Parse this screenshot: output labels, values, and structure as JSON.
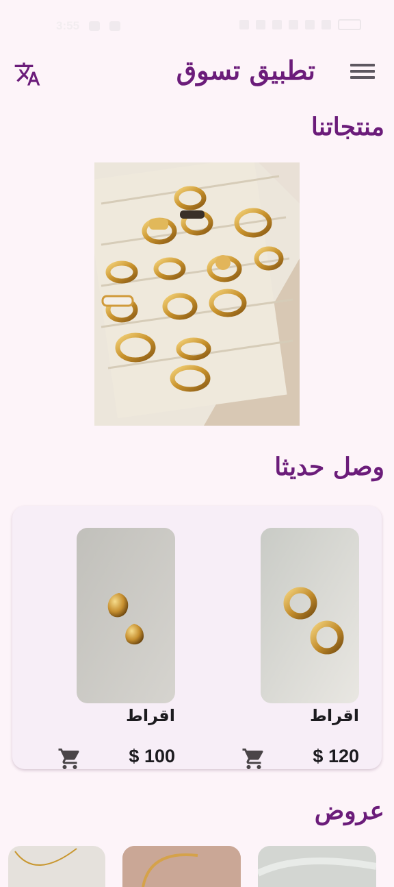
{
  "status_bar": {
    "time": "3:55"
  },
  "header": {
    "title": "تطبيق تسوق",
    "translate_icon": "translate-icon",
    "menu_icon": "menu-icon"
  },
  "sections": {
    "products_title": "منتجاتنا",
    "new_arrivals_title": "وصل حديثا",
    "offers_title": "عروض"
  },
  "new_arrivals": [
    {
      "name": "اقراط",
      "price": "$ 120",
      "icon": "cart-icon"
    },
    {
      "name": "اقراط",
      "price": "$ 100",
      "icon": "cart-icon"
    }
  ],
  "colors": {
    "accent": "#6b1c7a",
    "background": "#fdf4f9",
    "card": "#f7eef7"
  }
}
